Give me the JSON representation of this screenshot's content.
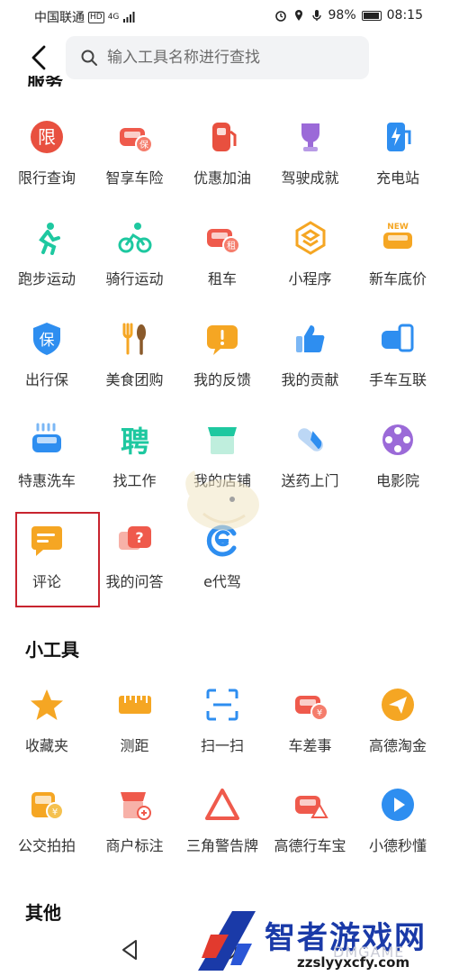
{
  "status_bar": {
    "carrier": "中国联通",
    "hd": "HD",
    "network": "4G",
    "battery": "98%",
    "time": "08:15"
  },
  "search": {
    "placeholder": "输入工具名称进行查找"
  },
  "sections": {
    "service_heading_partial": "服务",
    "tools_heading": "小工具",
    "other_heading": "其他"
  },
  "service_items": [
    {
      "label": "限行查询",
      "icon": "restriction-icon",
      "color": "#e8503f"
    },
    {
      "label": "智享车险",
      "icon": "car-insurance-icon",
      "color": "#ef5a4c"
    },
    {
      "label": "优惠加油",
      "icon": "fuel-pump-icon",
      "color": "#e8503f"
    },
    {
      "label": "驾驶成就",
      "icon": "trophy-icon",
      "color": "#9b6ad8"
    },
    {
      "label": "充电站",
      "icon": "charging-station-icon",
      "color": "#2e8ef0"
    },
    {
      "label": "跑步运动",
      "icon": "runner-icon",
      "color": "#1ec8a0"
    },
    {
      "label": "骑行运动",
      "icon": "cyclist-icon",
      "color": "#1ec8a0"
    },
    {
      "label": "租车",
      "icon": "car-rental-icon",
      "color": "#ef5a4c"
    },
    {
      "label": "小程序",
      "icon": "mini-program-icon",
      "color": "#f5a623"
    },
    {
      "label": "新车底价",
      "icon": "new-car-icon",
      "color": "#f5a623"
    },
    {
      "label": "出行保",
      "icon": "shield-icon",
      "color": "#2e8ef0"
    },
    {
      "label": "美食团购",
      "icon": "fork-spoon-icon",
      "color": "#f5a623"
    },
    {
      "label": "我的反馈",
      "icon": "feedback-icon",
      "color": "#f5a623"
    },
    {
      "label": "我的贡献",
      "icon": "thumbs-up-icon",
      "color": "#2e8ef0"
    },
    {
      "label": "手车互联",
      "icon": "phone-car-icon",
      "color": "#2e8ef0"
    },
    {
      "label": "特惠洗车",
      "icon": "car-wash-icon",
      "color": "#2e8ef0"
    },
    {
      "label": "找工作",
      "icon": "job-icon",
      "color": "#1ec8a0"
    },
    {
      "label": "我的店铺",
      "icon": "shop-icon",
      "color": "#1ec8a0"
    },
    {
      "label": "送药上门",
      "icon": "pill-icon",
      "color": "#2e8ef0"
    },
    {
      "label": "电影院",
      "icon": "film-reel-icon",
      "color": "#9b6ad8"
    },
    {
      "label": "评论",
      "icon": "comment-icon",
      "color": "#f5a623"
    },
    {
      "label": "我的问答",
      "icon": "qa-icon",
      "color": "#ef5a4c"
    },
    {
      "label": "e代驾",
      "icon": "e-driver-icon",
      "color": "#2e8ef0"
    }
  ],
  "tool_items": [
    {
      "label": "收藏夹",
      "icon": "star-icon",
      "color": "#f5a623"
    },
    {
      "label": "测距",
      "icon": "ruler-icon",
      "color": "#f5a623"
    },
    {
      "label": "扫一扫",
      "icon": "scan-icon",
      "color": "#2e8ef0"
    },
    {
      "label": "车差事",
      "icon": "car-errand-icon",
      "color": "#ef5a4c"
    },
    {
      "label": "高德淘金",
      "icon": "paper-plane-icon",
      "color": "#f5a623"
    },
    {
      "label": "公交拍拍",
      "icon": "bus-camera-icon",
      "color": "#f5a623"
    },
    {
      "label": "商户标注",
      "icon": "shop-mark-icon",
      "color": "#ef5a4c"
    },
    {
      "label": "三角警告牌",
      "icon": "warning-triangle-icon",
      "color": "#ef5a4c"
    },
    {
      "label": "高德行车宝",
      "icon": "dashcam-icon",
      "color": "#ef5a4c"
    },
    {
      "label": "小德秒懂",
      "icon": "play-icon",
      "color": "#2e8ef0"
    }
  ],
  "watermark": {
    "title": "智者游戏网",
    "url": "zzslyyxcfy.com",
    "ghost": "DMGAME"
  }
}
